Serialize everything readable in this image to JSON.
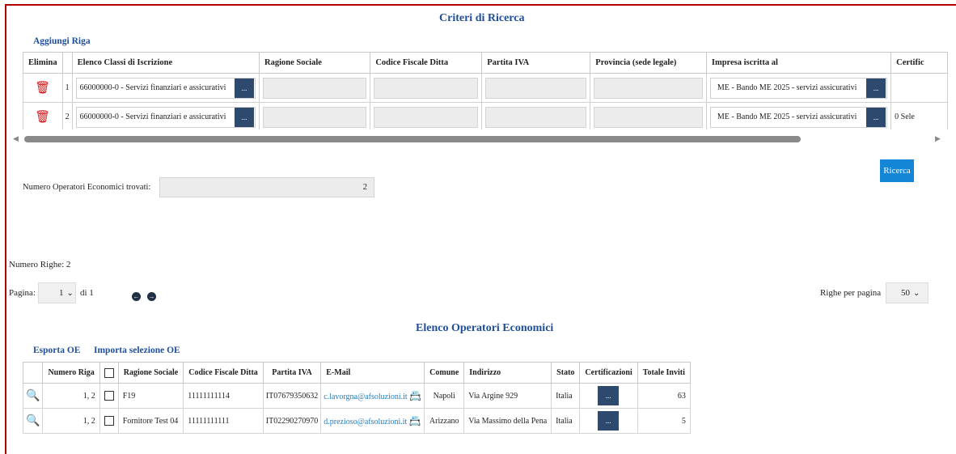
{
  "criteri": {
    "title": "Criteri di Ricerca",
    "add_row": "Aggiungi Riga",
    "headers": [
      "Elimina",
      "",
      "Elenco Classi di Iscrizione",
      "Ragione Sociale",
      "Codice Fiscale Ditta",
      "Partita IVA",
      "Provincia (sede legale)",
      "Impresa iscritta al",
      "Certific"
    ],
    "rows": [
      {
        "num": "1",
        "classe": "66000000-0 - Servizi finanziari e assicurativi",
        "impresa": "ME - Bando ME 2025 - servizi assicurativi",
        "cert": ""
      },
      {
        "num": "2",
        "classe": "66000000-0 - Servizi finanziari e assicurativi",
        "impresa": "ME - Bando ME 2025 - servizi assicurativi",
        "cert": "0 Sele"
      }
    ],
    "dots": "...",
    "ricerca_label": "Ricerca",
    "num_oe_label": "Numero Operatori Economici trovati:",
    "num_oe_value": "2"
  },
  "paging": {
    "numero_righe": "Numero Righe: 2",
    "pagina_label": "Pagina:",
    "pagina_value": "1",
    "di_label": "di 1",
    "righe_label": "Righe per pagina",
    "righe_value": "50"
  },
  "elenco": {
    "title": "Elenco Operatori Economici",
    "esporta": "Esporta OE",
    "importa": "Importa selezione OE",
    "headers": [
      "",
      "Numero Riga",
      "",
      "Ragione Sociale",
      "Codice Fiscale Ditta",
      "Partita IVA",
      "E-Mail",
      "Comune",
      "Indirizzo",
      "Stato",
      "Certificazioni",
      "Totale Inviti"
    ],
    "rows": [
      {
        "numero": "1, 2",
        "ragione": "F19",
        "cf": "11111111114",
        "piva": "IT07679350632",
        "email": "c.lavorgna@afsoluzioni.it",
        "comune": "Napoli",
        "indirizzo": "Via Argine 929",
        "stato": "Italia",
        "inviti": "63"
      },
      {
        "numero": "1, 2",
        "ragione": "Fornitore Test 04",
        "cf": "11111111111",
        "piva": "IT02290270970",
        "email": "d.prezioso@afsoluzioni.it",
        "comune": "Arizzano",
        "indirizzo": "Via Massimo della Pena",
        "stato": "Italia",
        "inviti": "5"
      }
    ],
    "dots": "..."
  },
  "colors": {
    "frame": "#b00000",
    "title": "#1f4e9a",
    "button": "#1486d6",
    "dots_button": "#2d4a6e",
    "trash": "#d21313"
  }
}
